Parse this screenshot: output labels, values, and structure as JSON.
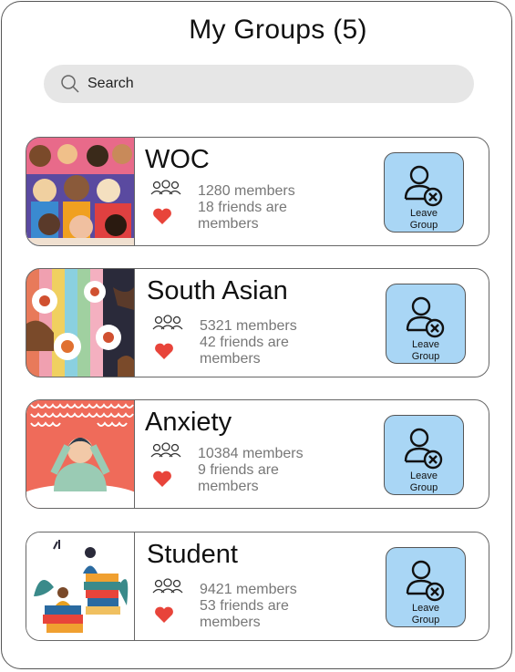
{
  "header": {
    "title": "My Groups (5)"
  },
  "search": {
    "placeholder": "Search",
    "icon": "search-icon"
  },
  "groups": [
    {
      "name": "WOC",
      "members": "1280 members",
      "friends_line1": "18 friends are",
      "friends_line2": "members",
      "leave_line1": "Leave",
      "leave_line2": "Group"
    },
    {
      "name": "South Asian",
      "members": "5321 members",
      "friends_line1": "42 friends are",
      "friends_line2": "members",
      "leave_line1": "Leave",
      "leave_line2": "Group"
    },
    {
      "name": "Anxiety",
      "members": "10384 members",
      "friends_line1": "9 friends are",
      "friends_line2": "members",
      "leave_line1": "Leave",
      "leave_line2": "Group"
    },
    {
      "name": "Student",
      "members": "9421 members",
      "friends_line1": "53 friends are",
      "friends_line2": "members",
      "leave_line1": "Leave",
      "leave_line2": "Group"
    }
  ],
  "colors": {
    "leave_button": "#a9d6f5",
    "heart": "#e8443a",
    "search_bg": "#e6e6e6"
  }
}
